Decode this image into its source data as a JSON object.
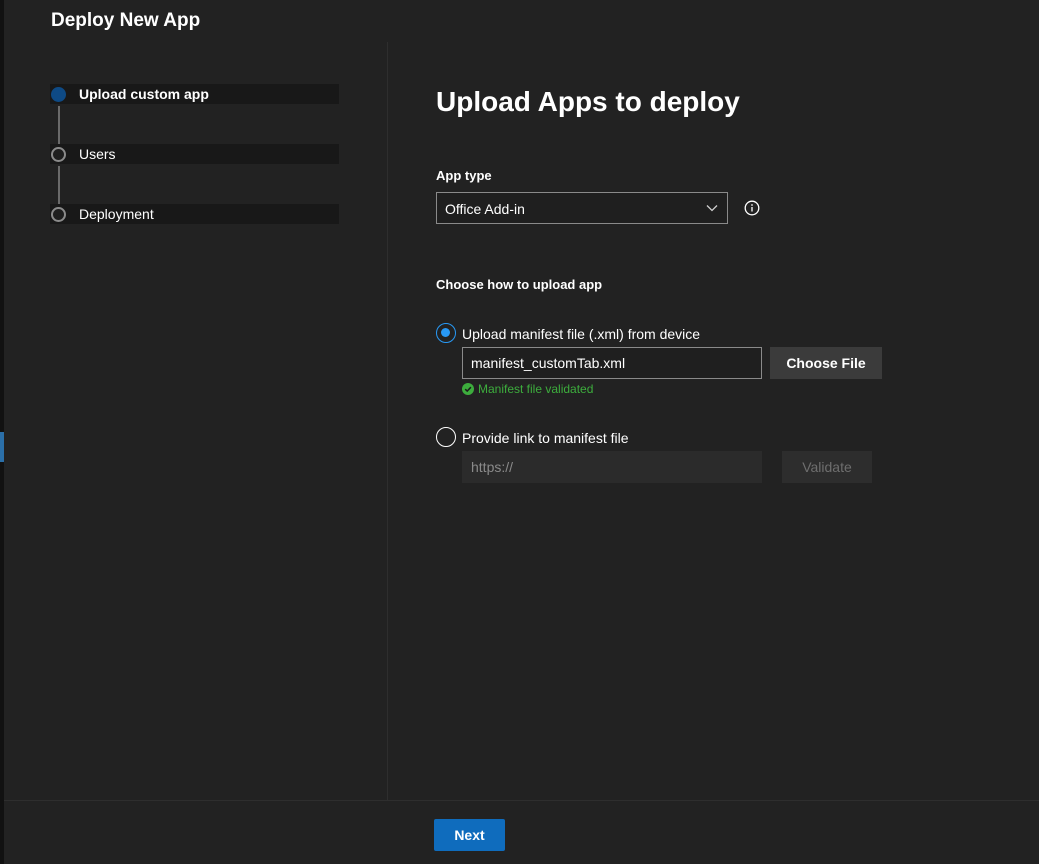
{
  "header": {
    "title": "Deploy New App"
  },
  "steps": [
    {
      "label": "Upload custom app",
      "active": true
    },
    {
      "label": "Users",
      "active": false
    },
    {
      "label": "Deployment",
      "active": false
    }
  ],
  "main": {
    "title": "Upload Apps to deploy",
    "app_type": {
      "label": "App type",
      "selected": "Office Add-in",
      "info_icon": "info-icon"
    },
    "upload": {
      "label": "Choose how to upload app",
      "option_device": {
        "label": "Upload manifest file (.xml) from device",
        "checked": true,
        "file_value": "manifest_customTab.xml",
        "choose_button": "Choose File",
        "status": "Manifest file validated"
      },
      "option_link": {
        "label": "Provide link to manifest file",
        "checked": false,
        "placeholder": "https://",
        "validate_button": "Validate"
      }
    }
  },
  "footer": {
    "next_button": "Next"
  },
  "colors": {
    "accent": "#0f6cbd",
    "radio": "#2899f5",
    "success": "#3dad3d",
    "active_step": "#0e4a85"
  }
}
